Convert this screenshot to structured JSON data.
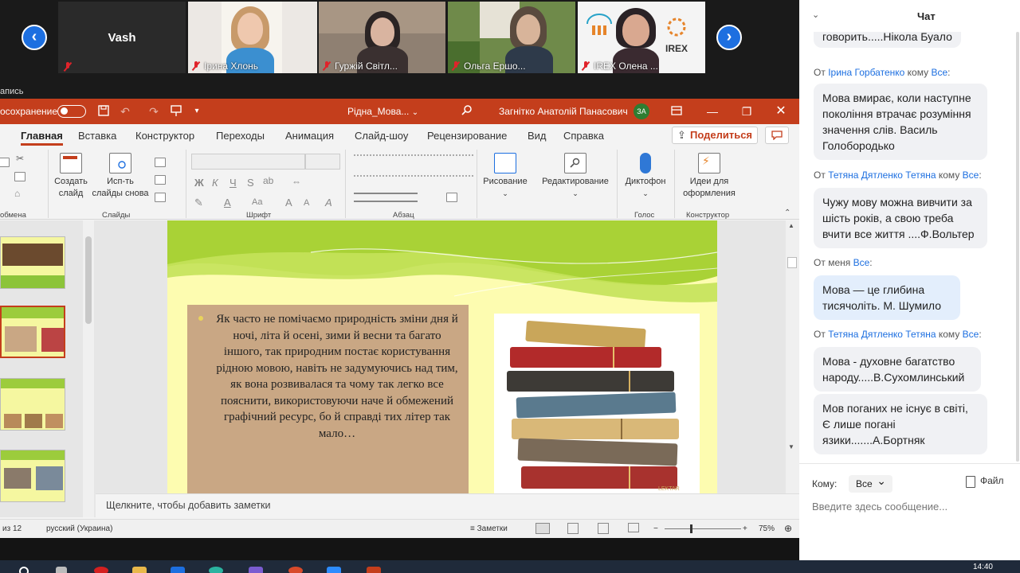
{
  "video_strip": {
    "participants": [
      {
        "name": "Vash",
        "kind": "name-only"
      },
      {
        "name": "Ірина Хлонь",
        "kind": "video"
      },
      {
        "name": "Гуржій Світл...",
        "kind": "video"
      },
      {
        "name": "Ольга Ершо...",
        "kind": "video"
      },
      {
        "name": "IREX Олена ...",
        "kind": "video",
        "logo_text": "IREX"
      }
    ],
    "recording_label": "апись"
  },
  "ppt": {
    "autosave_label": "осохранение",
    "doc_title": "Рідна_Мова...",
    "doc_title_chevron": "⌄",
    "user_name": "Загнітко Анатолій Панасович",
    "user_initials": "ЗА",
    "tabs": [
      "Главная",
      "Вставка",
      "Конструктор",
      "Переходы",
      "Анимация",
      "Слайд-шоу",
      "Рецензирование",
      "Вид",
      "Справка"
    ],
    "share_label": "Поделиться",
    "ribbon": {
      "create_slide": "Создать слайд",
      "reuse_slides": "Исп-ть слайды снова",
      "drawing": "Рисование",
      "editing": "Редактирование",
      "dictaphone": "Диктофон",
      "design_ideas": "Идеи для оформления",
      "groups": {
        "clipboard": "обмена",
        "slides": "Слайды",
        "font": "Шрифт",
        "paragraph": "Абзац",
        "voice": "Голос",
        "designer": "Конструктор"
      },
      "font_glyphs": {
        "bold": "Ж",
        "italic": "К",
        "underline": "Ч",
        "strike": "S",
        "case": "Aa",
        "grow": "A",
        "shrink": "A"
      }
    },
    "slide_text": "Як часто не помічаємо природність зміни дня й ночі, літа й осені, зими й весни та багато іншого, так природним постає користування рідною мовою, навіть не задумуючись над тим, як вона розвивалася та чому так легко все пояснити, використовуючи наче й обмежений графічний ресурс, бо й справді тих літер так мало…",
    "image_caption": "LEKTAR",
    "notes_placeholder": "Щелкните, чтобы добавить заметки",
    "status": {
      "slide_count": "из 12",
      "language": "русский (Украина)",
      "notes_button": "Заметки",
      "zoom": "75%"
    },
    "clock": "14:40",
    "colors": {
      "accent": "#c43e1c",
      "slide_bg": "#fdfcb0",
      "quote_box": "#c9a784"
    }
  },
  "chat": {
    "title": "Чат",
    "messages": [
      {
        "from": "",
        "to": "",
        "text": "говорить.....Нікола Буало",
        "me": false,
        "partial": true
      },
      {
        "from": "Ірина Горбатенко",
        "to": "Все",
        "text": "Мова вмирає, коли наступне покоління втрачає розуміння значення слів. Василь Голобородько",
        "me": false
      },
      {
        "from": "Тетяна Дятленко Тетяна",
        "to": "Все",
        "text": "Чужу мову можна вивчити за шість років, а свою треба вчити все життя ....Ф.Вольтер",
        "me": false
      },
      {
        "from": "меня",
        "to": "Все",
        "text": "Мова — це глибина тисячоліть.  М. Шумило",
        "me": true
      },
      {
        "from": "Тетяна Дятленко Тетяна",
        "to": "Все",
        "text": "Мова - духовне багатство народу.....В.Сухомлинський",
        "me": false
      },
      {
        "from": "",
        "to": "",
        "text": "Мов поганих не існує в світі, Є лише погані язики.......А.Бортняк",
        "me": false
      }
    ],
    "meta_from_prefix": "От",
    "meta_to_word": "кому",
    "recipient_label": "Кому:",
    "recipient_value": "Все",
    "file_label": "Файл",
    "input_placeholder": "Введите здесь сообщение..."
  }
}
